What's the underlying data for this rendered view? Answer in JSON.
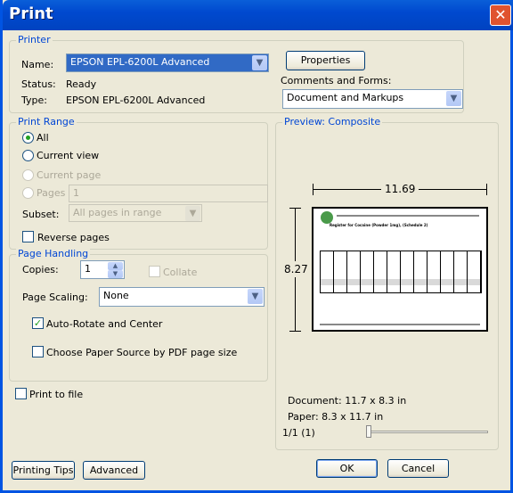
{
  "window": {
    "title": "Print"
  },
  "printer": {
    "group_label": "Printer",
    "name_label": "Name:",
    "name_value": "EPSON EPL-6200L Advanced",
    "status_label": "Status:",
    "status_value": "Ready",
    "type_label": "Type:",
    "type_value": "EPSON EPL-6200L Advanced",
    "properties": "Properties",
    "comments_label": "Comments and Forms:",
    "comments_value": "Document and Markups"
  },
  "range": {
    "group_label": "Print Range",
    "all": "All",
    "current_view": "Current view",
    "current_page": "Current page",
    "pages": "Pages",
    "pages_value": "1",
    "subset_label": "Subset:",
    "subset_value": "All pages in range",
    "reverse": "Reverse pages",
    "selected": "All"
  },
  "handling": {
    "group_label": "Page Handling",
    "copies_label": "Copies:",
    "copies_value": "1",
    "collate": "Collate",
    "scaling_label": "Page Scaling:",
    "scaling_value": "None",
    "auto_rotate": "Auto-Rotate and Center",
    "auto_rotate_checked": true,
    "paper_source": "Choose Paper Source by PDF page size",
    "paper_source_checked": false
  },
  "print_to_file": "Print to file",
  "preview": {
    "group_label": "Preview: Composite",
    "width": "11.69",
    "height": "8.27",
    "doc_title": "Register for Cocaine (Powder 1mg), (Schedule 2)",
    "document": "Document: 11.7 x 8.3 in",
    "paper": "Paper: 8.3 x 11.7 in",
    "page": "1/1 (1)"
  },
  "buttons": {
    "tips": "Printing Tips",
    "advanced": "Advanced",
    "ok": "OK",
    "cancel": "Cancel"
  }
}
